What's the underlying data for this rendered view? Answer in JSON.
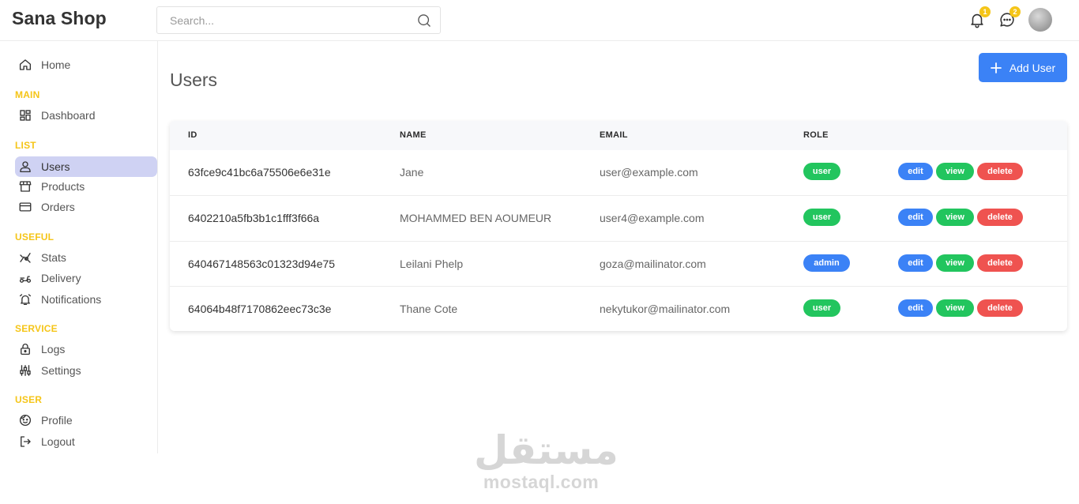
{
  "app": {
    "title": "Sana Shop"
  },
  "search": {
    "placeholder": "Search..."
  },
  "header": {
    "notifications_count": "1",
    "messages_count": "2"
  },
  "sidebar": {
    "home": "Home",
    "sections": {
      "main": "MAIN",
      "list": "LIST",
      "useful": "USEFUL",
      "service": "SERVICE",
      "user": "USER"
    },
    "items": {
      "dashboard": "Dashboard",
      "users": "Users",
      "products": "Products",
      "orders": "Orders",
      "stats": "Stats",
      "delivery": "Delivery",
      "notifications": "Notifications",
      "logs": "Logs",
      "settings": "Settings",
      "profile": "Profile",
      "logout": "Logout"
    }
  },
  "main": {
    "title": "Users",
    "add_button": "Add User",
    "table": {
      "headers": {
        "id": "ID",
        "name": "NAME",
        "email": "EMAIL",
        "role": "ROLE"
      },
      "actions": {
        "edit": "edit",
        "view": "view",
        "delete": "delete"
      },
      "rows": [
        {
          "id": "63fce9c41bc6a75506e6e31e",
          "name": "Jane",
          "email": "user@example.com",
          "role": "user"
        },
        {
          "id": "6402210a5fb3b1c1fff3f66a",
          "name": "MOHAMMED BEN AOUMEUR",
          "email": "user4@example.com",
          "role": "user"
        },
        {
          "id": "640467148563c01323d94e75",
          "name": "Leilani Phelp",
          "email": "goza@mailinator.com",
          "role": "admin"
        },
        {
          "id": "64064b48f7170862eec73c3e",
          "name": "Thane Cote",
          "email": "nekytukor@mailinator.com",
          "role": "user"
        }
      ]
    }
  },
  "watermark": {
    "arabic": "مستقل",
    "latin": "mostaql.com"
  },
  "colors": {
    "accent": "#3b82f6",
    "success": "#22c55e",
    "danger": "#ef5350",
    "section": "#f5c518",
    "active_bg": "#cfd2f3"
  }
}
